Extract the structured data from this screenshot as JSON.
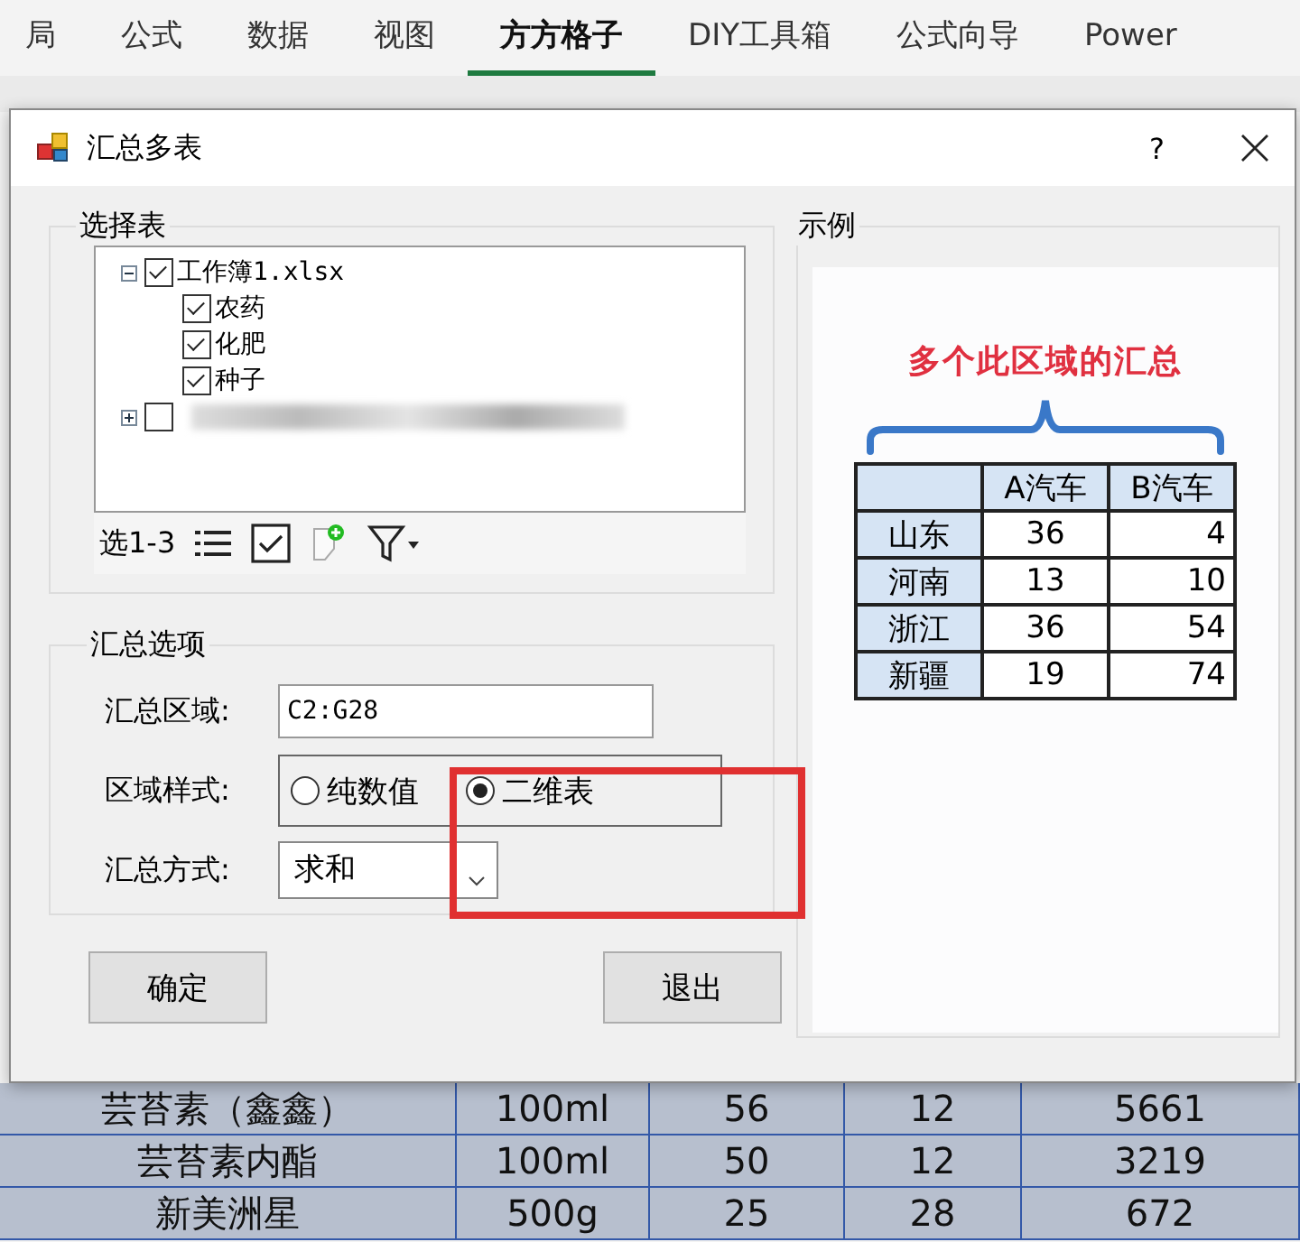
{
  "ribbon_tabs": [
    {
      "label": "局",
      "selected": false
    },
    {
      "label": "公式",
      "selected": false
    },
    {
      "label": "数据",
      "selected": false
    },
    {
      "label": "视图",
      "selected": false
    },
    {
      "label": "方方格子",
      "selected": true
    },
    {
      "label": "DIY工具箱",
      "selected": false
    },
    {
      "label": "公式向导",
      "selected": false
    },
    {
      "label": "Power",
      "selected": false
    }
  ],
  "dialog": {
    "title": "汇总多表",
    "help": "?",
    "select_group": {
      "title": "选择表",
      "tree": [
        {
          "label": "工作簿1.xlsx",
          "checked": true,
          "expanded": true,
          "children": [
            {
              "label": "农药",
              "checked": true
            },
            {
              "label": "化肥",
              "checked": true
            },
            {
              "label": "种子",
              "checked": true
            }
          ]
        },
        {
          "checked": false,
          "expanded": false
        }
      ],
      "toolbar_label": "选1-3"
    },
    "options_group": {
      "title": "汇总选项",
      "range_label": "汇总区域:",
      "range_value": "C2:G28",
      "style_label": "区域样式:",
      "style_options": [
        {
          "label": "纯数值",
          "selected": false
        },
        {
          "label": "二维表",
          "selected": true
        }
      ],
      "method_label": "汇总方式:",
      "method_value": "求和"
    },
    "buttons": [
      "确定",
      "退出"
    ],
    "example_group": {
      "title": "示例",
      "caption": "多个此区域的汇总",
      "columns": [
        "",
        "A汽车",
        "B汽车"
      ],
      "rows": [
        [
          "山东",
          "36",
          "4"
        ],
        [
          "河南",
          "13",
          "10"
        ],
        [
          "浙江",
          "36",
          "54"
        ],
        [
          "新疆",
          "19",
          "74"
        ]
      ]
    }
  },
  "sheet_rows": [
    [
      "芸苔素（鑫鑫）",
      "100ml",
      "56",
      "12",
      "5661"
    ],
    [
      "芸苔素内酯",
      "100ml",
      "50",
      "12",
      "3219"
    ],
    [
      "新美洲星",
      "500g",
      "25",
      "28",
      "672"
    ]
  ]
}
